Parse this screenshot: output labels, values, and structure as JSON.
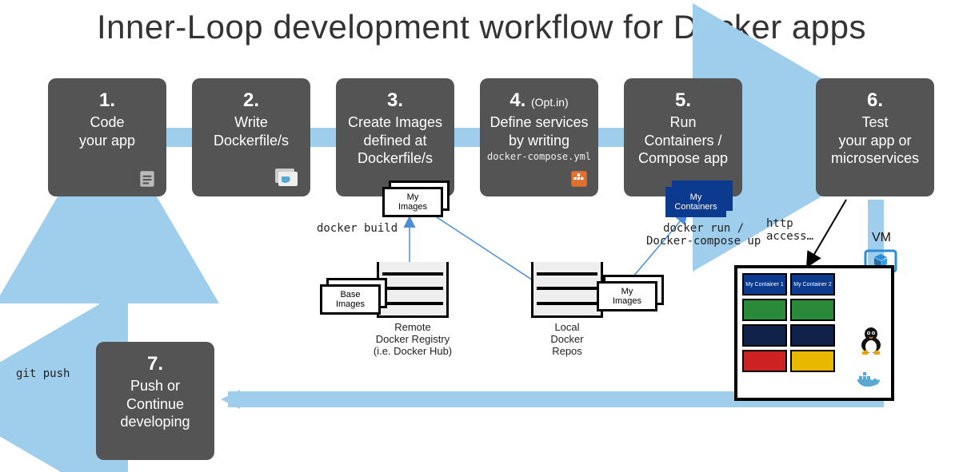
{
  "title": "Inner-Loop development workflow for Docker apps",
  "steps": {
    "s1": {
      "num": "1.",
      "text": "Code\nyour app"
    },
    "s2": {
      "num": "2.",
      "text": "Write\nDockerfile/s"
    },
    "s3": {
      "num": "3.",
      "text": "Create Images\ndefined at\nDockerfile/s"
    },
    "s4": {
      "num": "4.",
      "opt": "(Opt.in)",
      "text": "Define services\nby writing",
      "sub": "docker-compose.yml"
    },
    "s5": {
      "num": "5.",
      "text": "Run\nContainers /\nCompose app"
    },
    "s6": {
      "num": "6.",
      "text": "Test\nyour app or\nmicroservices"
    },
    "s7": {
      "num": "7.",
      "text": "Push or\nContinue\ndeveloping"
    }
  },
  "labels": {
    "docker_build": "docker build",
    "docker_run": "docker run /\nDocker-compose up",
    "http_access": "http\naccess…",
    "git_push": "git push",
    "vm": "VM"
  },
  "image_boxes": {
    "my_images_1": "My\nImages",
    "base_images": "Base\nImages",
    "my_images_2": "My\nImages",
    "my_containers": "My\nContainers"
  },
  "registries": {
    "remote": "Remote\nDocker Registry\n(i.e. Docker Hub)",
    "local": "Local\nDocker\nRepos"
  },
  "vm": {
    "container1": "My\nContainer 1",
    "container2": "My\nContainer 2"
  },
  "icon_names": {
    "file": "file-icon",
    "docker": "docker-icon",
    "compose": "docker-compose-icon",
    "screen": "monitor-icon",
    "cube": "cube-icon",
    "tux": "linux-icon"
  }
}
